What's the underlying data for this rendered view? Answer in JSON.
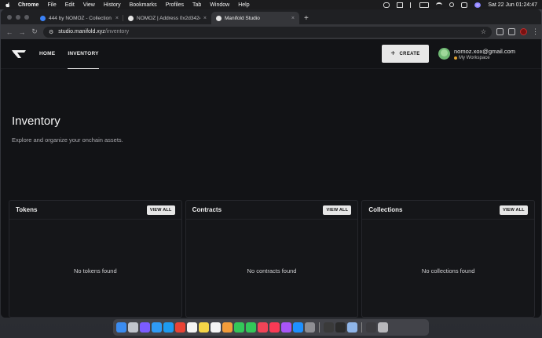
{
  "menubar": {
    "app": "Chrome",
    "items": [
      "File",
      "Edit",
      "View",
      "History",
      "Bookmarks",
      "Profiles",
      "Tab",
      "Window",
      "Help"
    ],
    "clock": "Sat 22 Jun  01:24:47"
  },
  "browser": {
    "tabs": [
      {
        "title": "444 by NOMOZ - Collection |",
        "favicon_color": "#3b82f6"
      },
      {
        "title": "NOMOZ | Address 0x2d3424",
        "favicon_color": "#e5e5e5"
      },
      {
        "title": "Manifold Studio",
        "favicon_color": "#e5e5e5"
      }
    ],
    "new_tab": "+",
    "url_host": "studio.manifold.xyz",
    "url_path": "/inventory"
  },
  "site": {
    "nav": {
      "home": "HOME",
      "inventory": "INVENTORY"
    },
    "create_label": "CREATE",
    "account": {
      "email": "nomoz.xox@gmail.com",
      "workspace": "My Workspace"
    }
  },
  "main": {
    "title": "Inventory",
    "subtitle": "Explore and organize your onchain assets.",
    "view_all_label": "VIEW ALL",
    "cards": [
      {
        "title": "Tokens",
        "empty": "No tokens found"
      },
      {
        "title": "Contracts",
        "empty": "No contracts found"
      },
      {
        "title": "Collections",
        "empty": "No collections found"
      }
    ]
  },
  "dock": {
    "icons": [
      {
        "name": "finder-icon",
        "color": "#3b8cf0"
      },
      {
        "name": "launchpad-icon",
        "color": "#c0c4cc"
      },
      {
        "name": "siri-icon",
        "color": "#7b5cff"
      },
      {
        "name": "safari-icon",
        "color": "#2f9bf5"
      },
      {
        "name": "twitter-icon",
        "color": "#1d9bf0"
      },
      {
        "name": "chrome-icon",
        "color": "#ea4335"
      },
      {
        "name": "calendar-icon",
        "color": "#f4f4f4"
      },
      {
        "name": "notes-icon",
        "color": "#f5d547"
      },
      {
        "name": "reminders-icon",
        "color": "#f4f4f4"
      },
      {
        "name": "photos-icon",
        "color": "#f29c3a"
      },
      {
        "name": "facetime-icon",
        "color": "#33c759"
      },
      {
        "name": "messages-icon",
        "color": "#33c759"
      },
      {
        "name": "news-icon",
        "color": "#f24457"
      },
      {
        "name": "music-icon",
        "color": "#fa3a55"
      },
      {
        "name": "podcasts-icon",
        "color": "#a855f7"
      },
      {
        "name": "appstore-icon",
        "color": "#1e90ff"
      },
      {
        "name": "settings-icon",
        "color": "#8e8e93"
      }
    ],
    "icons_right": [
      {
        "name": "activity-monitor-icon",
        "color": "#3a3a3a"
      },
      {
        "name": "terminal-icon",
        "color": "#2b2b2b"
      },
      {
        "name": "preview-icon",
        "color": "#8fb5e8"
      }
    ],
    "icons_far": [
      {
        "name": "downloads-icon",
        "color": "#3c3c40"
      },
      {
        "name": "trash-icon",
        "color": "#b8b8bc"
      }
    ]
  }
}
